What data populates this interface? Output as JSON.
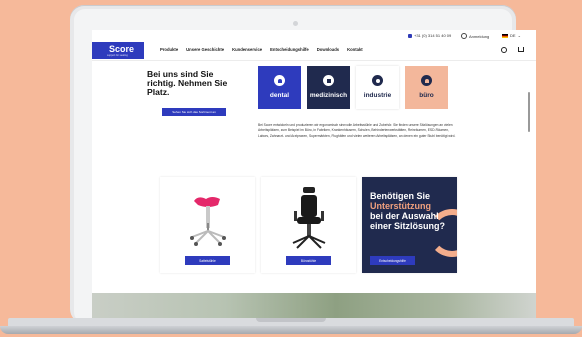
{
  "topbar": {
    "phone": "+31 (0) 314 51 40 09",
    "login": "Anmeldung",
    "language": "DE"
  },
  "nav": {
    "logo": "Score",
    "logo_sub": "support for seating",
    "links": [
      "Produkte",
      "Unsere Geschichte",
      "Kundenservice",
      "Entscheidungshilfe",
      "Downloads",
      "Kontakt"
    ]
  },
  "hero": {
    "title": "Bei uns sind Sie richtig. Nehmen Sie Platz.",
    "cta": "Sehen Sie sich das Sortiment an",
    "description": "Bei Score entwickeln und produzieren wir ergonomisch sinnvolle Arbeitsstühle und Zubehör. Sie finden unsere Sitzlösungen an vielen Arbeitsplätzen, zum Beispiel im Büro, in Fabriken, Krankenhäusern, Schulen, Behindertenwerkstätten, Reinräumen, ESD-Räumen, Labors, Zahnarzt- und Arztpraxen, Supermärkten, Flughäfen und vielen weiteren Arbeitsplätzen, an denen ein guter Stuhl benötigt wird."
  },
  "categories": [
    {
      "label": "dental",
      "bg": "#2e3bbd",
      "fg": "#ffffff",
      "icon": "tooth-icon"
    },
    {
      "label": "medizinisch",
      "bg": "#202a4e",
      "fg": "#ffffff",
      "icon": "medical-cross-icon"
    },
    {
      "label": "industrie",
      "bg": "#ffffff",
      "fg": "#202a4e",
      "icon": "gear-icon"
    },
    {
      "label": "büro",
      "bg": "#f3b79b",
      "fg": "#202a4e",
      "icon": "office-chair-icon"
    }
  ],
  "cards": {
    "saddle_button": "Sattelstühle",
    "office_button": "Bürostühle",
    "help_title_1": "Benötigen Sie",
    "help_title_hl": "Unterstützung",
    "help_title_2": "bei der Auswahl einer Sitzlösung?",
    "help_button": "Entscheidungshilfe"
  },
  "colors": {
    "brand_blue": "#2e3bbd",
    "navy": "#202a4e",
    "peach": "#f3b79b"
  }
}
